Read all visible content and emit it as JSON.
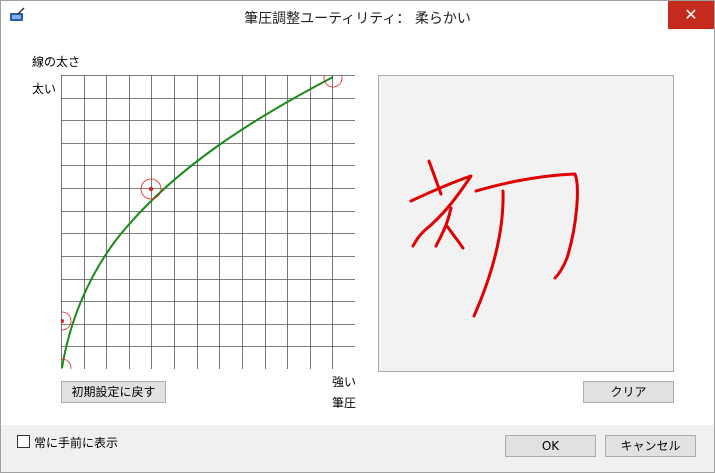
{
  "window": {
    "title": "筆圧調整ユーティリティ：  柔らかい",
    "close_glyph": "✕",
    "app_icon": "pen-tablet-icon"
  },
  "graph": {
    "y_axis_title": "線の太さ",
    "y_top_label": "太い",
    "x_right_label": "強い",
    "x_axis_title": "筆圧",
    "reset_button": "初期設定に戻す",
    "curve_color": "#1a8a1a",
    "control_point_color": "#e02020",
    "grid_divisions": 13
  },
  "preview": {
    "clear_button": "クリア",
    "stroke_color": "#e00000",
    "drawn_character": "初"
  },
  "footer": {
    "always_on_top_label": "常に手前に表示",
    "always_on_top_checked": false,
    "ok_button": "OK",
    "cancel_button": "キャンセル"
  }
}
